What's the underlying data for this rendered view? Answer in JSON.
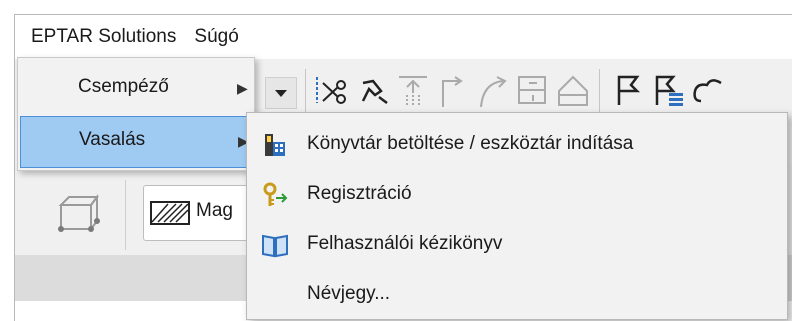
{
  "menubar": {
    "items": [
      "EPTAR Solutions",
      "Súgó"
    ]
  },
  "menu_level1": {
    "items": [
      {
        "label": "Csempéző",
        "selected": false
      },
      {
        "label": "Vasalás",
        "selected": true
      }
    ]
  },
  "submenu": {
    "items": [
      {
        "label": "Könyvtár betöltése / eszköztár indítása",
        "icon": "library-toolbar-icon"
      },
      {
        "label": "Regisztráció",
        "icon": "key-arrow-icon"
      },
      {
        "label": "Felhasználói kézikönyv",
        "icon": "book-icon"
      },
      {
        "label": "Névjegy...",
        "icon": ""
      }
    ]
  },
  "property_box": {
    "label": "Mag"
  },
  "colors": {
    "selected_bg": "#9fcaf2",
    "selected_border": "#4d8fd8"
  }
}
